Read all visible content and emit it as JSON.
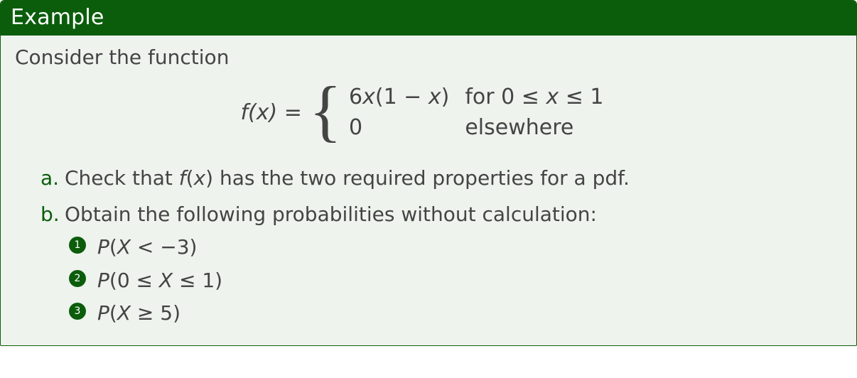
{
  "header": {
    "title": "Example"
  },
  "intro": "Consider the function",
  "equation": {
    "lhs": "f(x) =",
    "case1_expr": "6x(1 − x)",
    "case1_cond": "for 0 ≤ x ≤ 1",
    "case2_expr": "0",
    "case2_cond": "elsewhere"
  },
  "items": {
    "a": "Check that f(x) has the two required properties for a pdf.",
    "b": "Obtain the following probabilities without calculation:",
    "b_sub": [
      "P(X < −3)",
      "P(0 ≤ X ≤ 1)",
      "P(X ≥ 5)"
    ]
  }
}
